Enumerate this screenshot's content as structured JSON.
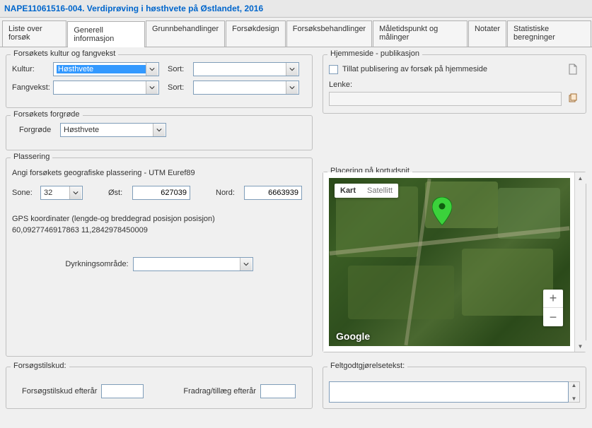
{
  "title": "NAPE11061516-004. Verdiprøving i høsthvete på Østlandet, 2016",
  "tabs": [
    {
      "id": "liste",
      "label": "Liste over forsøk"
    },
    {
      "id": "gen",
      "label": "Generell informasjon",
      "active": true
    },
    {
      "id": "grunn",
      "label": "Grunnbehandlinger"
    },
    {
      "id": "design",
      "label": "Forsøkdesign"
    },
    {
      "id": "beh",
      "label": "Forsøksbehandlinger"
    },
    {
      "id": "mal",
      "label": "Måletidspunkt og målinger"
    },
    {
      "id": "not",
      "label": "Notater"
    },
    {
      "id": "stat",
      "label": "Statistiske beregninger"
    }
  ],
  "kultur_fangvekst": {
    "legend": "Forsøkets kultur og fangvekst",
    "kultur_label": "Kultur:",
    "kultur_value": "Høsthvete",
    "sort1_label": "Sort:",
    "sort1_value": "",
    "fangvekst_label": "Fangvekst:",
    "fangvekst_value": "",
    "sort2_label": "Sort:",
    "sort2_value": ""
  },
  "forgrode": {
    "legend": "Forsøkets forgrøde",
    "label": "Forgrøde",
    "value": "Høsthvete"
  },
  "plassering": {
    "legend": "Plassering",
    "desc": "Angi forsøkets geografiske plassering - UTM Euref89",
    "sone_label": "Sone:",
    "sone_value": "32",
    "ost_label": "Øst:",
    "ost_value": "627039",
    "nord_label": "Nord:",
    "nord_value": "6663939",
    "gps_label": "GPS koordinater (lengde-og breddegrad posisjon posisjon)",
    "gps_value": "60,0927746917863   11,2842978450009",
    "dyrk_label": "Dyrkningsområde:",
    "dyrk_value": ""
  },
  "hjemmeside": {
    "legend": "Hjemmeside - publikasjon",
    "tillat_label": "Tillat publisering av forsøk på hjemmeside",
    "lenke_label": "Lenke:"
  },
  "mapsection": {
    "legend": "Placering på kortudsnit",
    "kart": "Kart",
    "satellitt": "Satellitt",
    "logo": "Google",
    "zoom_in": "+",
    "zoom_out": "−"
  },
  "tilskud": {
    "legend": "Forsøgstilskud:",
    "efteraar_label": "Forsøgstilskud efterår",
    "fradrag_label": "Fradrag/tillæg efterår",
    "felttext_label": "Feltgodtgjørelsetekst:"
  }
}
